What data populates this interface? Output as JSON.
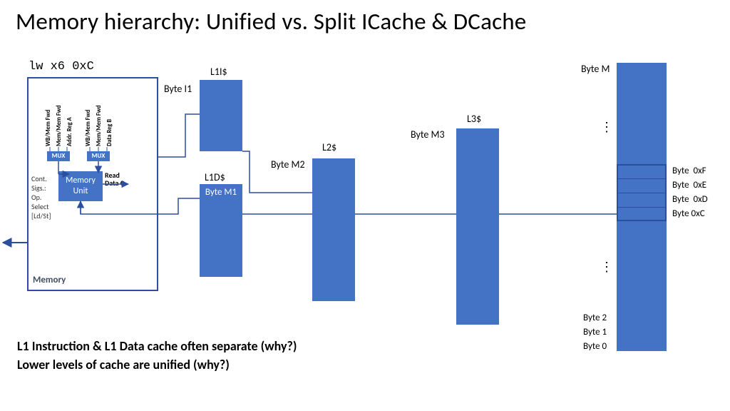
{
  "title": "Memory hierarchy: Unified vs. Split ICache & DCache",
  "instruction": "lw x6 0xC",
  "memoryStage": {
    "label": "Memory",
    "controlSignals": "Cont.\nSigs.:\nOp.\nSelect\n[Ld/St]",
    "readData": "Read\nData C",
    "mux": "MUX",
    "memoryUnit": "Memory\nUnit",
    "inputs": [
      "WB/Mem Fwd",
      "Mem/Mem Fwd",
      "Addr. Reg A",
      "WB/Mem Fwd",
      "Mem/Mem Fwd",
      "Data Reg B"
    ]
  },
  "caches": {
    "l1i": {
      "label": "L1I$",
      "byteLabel": "Byte I1"
    },
    "l1d": {
      "label": "L1D$",
      "byteLabel": "Byte M1"
    },
    "l2": {
      "label": "L2$",
      "byteLabel": "Byte M2"
    },
    "l3": {
      "label": "L3$",
      "byteLabel": "Byte M3"
    }
  },
  "mainMemory": {
    "topLabel": "Byte M",
    "bytes": [
      "Byte  0xF",
      "Byte  0xE",
      "Byte  0xD",
      "Byte 0xC"
    ],
    "bottomBytes": [
      "Byte 2",
      "Byte 1",
      "Byte 0"
    ],
    "dots": "⋮"
  },
  "footer": {
    "line1": "L1 Instruction & L1 Data cache often separate (why?)",
    "line2": "Lower levels of cache are unified (why?)"
  }
}
